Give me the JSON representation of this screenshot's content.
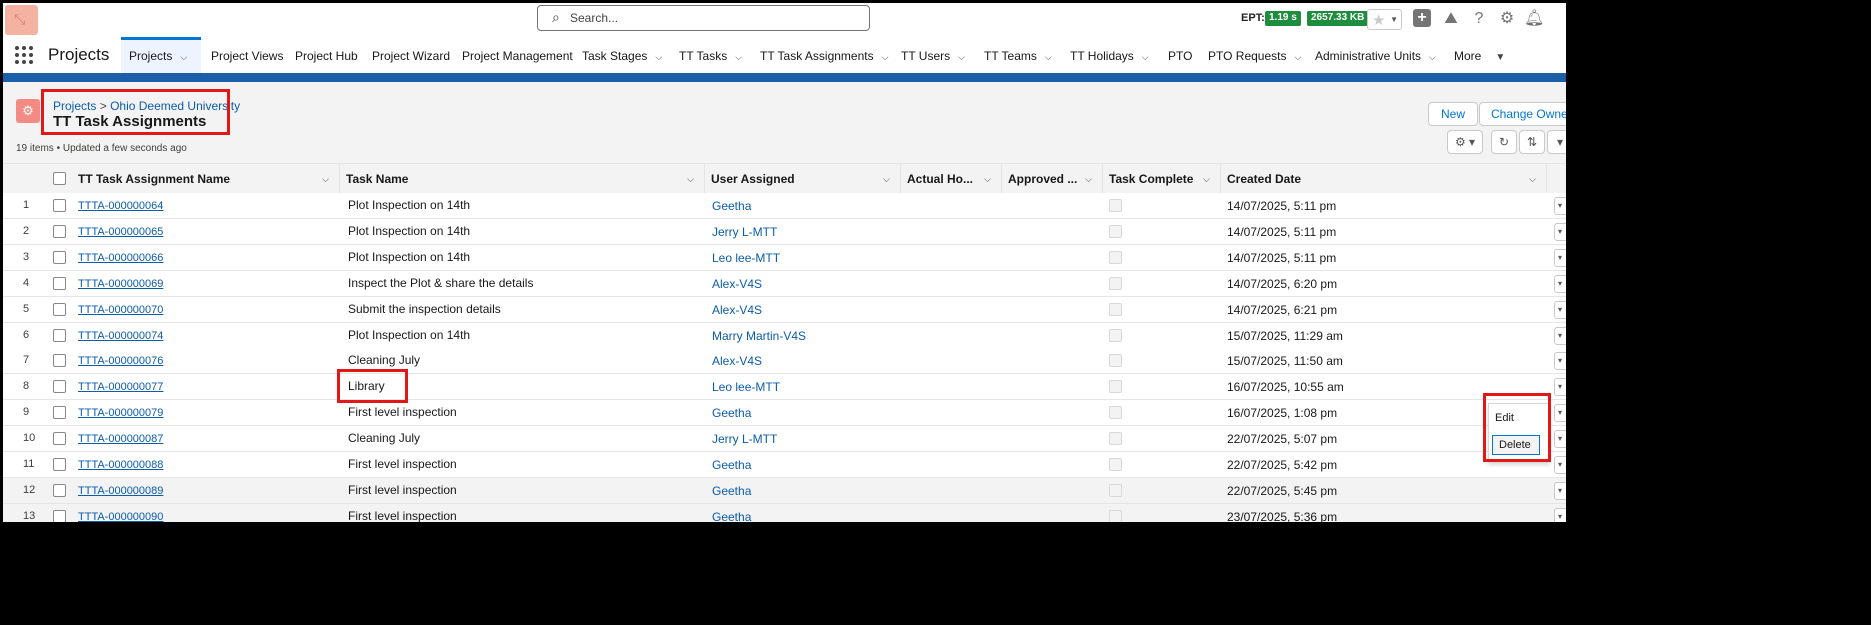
{
  "header": {
    "search_placeholder": "Search...",
    "ept_label": "EPT:",
    "ept_time": "1.19 s",
    "ept_size": "2657.33 KB"
  },
  "nav": {
    "app_name": "Projects",
    "items": [
      {
        "label": "Projects",
        "active": true,
        "dropdown": true
      },
      {
        "label": "Project Views"
      },
      {
        "label": "Project Hub"
      },
      {
        "label": "Project Wizard"
      },
      {
        "label": "Project Management"
      },
      {
        "label": "Task Stages",
        "dropdown": true
      },
      {
        "label": "TT Tasks",
        "dropdown": true
      },
      {
        "label": "TT Task Assignments",
        "dropdown": true
      },
      {
        "label": "TT Users",
        "dropdown": true
      },
      {
        "label": "TT Teams",
        "dropdown": true
      },
      {
        "label": "TT Holidays",
        "dropdown": true
      },
      {
        "label": "PTO"
      },
      {
        "label": "PTO Requests",
        "dropdown": true
      },
      {
        "label": "Administrative Units",
        "dropdown": true
      },
      {
        "label": "More",
        "dropdown": true
      }
    ]
  },
  "page": {
    "breadcrumb_root": "Projects",
    "breadcrumb_sep": ">",
    "breadcrumb_record": "Ohio Deemed University",
    "title": "TT Task Assignments",
    "meta": "19 items • Updated a few seconds ago",
    "new_button": "New",
    "change_owner_button": "Change Owner"
  },
  "table": {
    "columns": [
      "TT Task Assignment Name",
      "Task Name",
      "User Assigned",
      "Actual Ho...",
      "Approved ...",
      "Task Complete",
      "Created Date"
    ],
    "rows": [
      {
        "num": "1",
        "name": "TTTA-000000064",
        "task": "Plot Inspection on 14th",
        "user": "Geetha",
        "date": "14/07/2025, 5:11 pm"
      },
      {
        "num": "2",
        "name": "TTTA-000000065",
        "task": "Plot Inspection on 14th",
        "user": "Jerry L-MTT",
        "date": "14/07/2025, 5:11 pm"
      },
      {
        "num": "3",
        "name": "TTTA-000000066",
        "task": "Plot Inspection on 14th",
        "user": "Leo lee-MTT",
        "date": "14/07/2025, 5:11 pm"
      },
      {
        "num": "4",
        "name": "TTTA-000000069",
        "task": "Inspect the Plot & share the details",
        "user": "Alex-V4S",
        "date": "14/07/2025, 6:20 pm"
      },
      {
        "num": "5",
        "name": "TTTA-000000070",
        "task": "Submit the inspection details",
        "user": "Alex-V4S",
        "date": "14/07/2025, 6:21 pm"
      },
      {
        "num": "6",
        "name": "TTTA-000000074",
        "task": "Plot Inspection on 14th",
        "user": "Marry Martin-V4S",
        "date": "15/07/2025, 11:29 am"
      },
      {
        "num": "7",
        "name": "TTTA-000000076",
        "task": "Cleaning July",
        "user": "Alex-V4S",
        "date": "15/07/2025, 11:50 am"
      },
      {
        "num": "8",
        "name": "TTTA-000000077",
        "task": "Library",
        "user": "Leo lee-MTT",
        "date": "16/07/2025, 10:55 am"
      },
      {
        "num": "9",
        "name": "TTTA-000000079",
        "task": "First level inspection",
        "user": "Geetha",
        "date": "16/07/2025, 1:08 pm"
      },
      {
        "num": "10",
        "name": "TTTA-000000087",
        "task": "Cleaning July",
        "user": "Jerry L-MTT",
        "date": "22/07/2025, 5:07 pm"
      },
      {
        "num": "11",
        "name": "TTTA-000000088",
        "task": "First level inspection",
        "user": "Geetha",
        "date": "22/07/2025, 5:42 pm"
      },
      {
        "num": "12",
        "name": "TTTA-000000089",
        "task": "First level inspection",
        "user": "Geetha",
        "date": "22/07/2025, 5:45 pm"
      },
      {
        "num": "13",
        "name": "TTTA-000000090",
        "task": "First level inspection",
        "user": "Geetha",
        "date": "23/07/2025, 5:36 pm"
      }
    ]
  },
  "row_menu": {
    "edit": "Edit",
    "delete": "Delete"
  },
  "colors": {
    "accent": "#0176d3",
    "link": "#0b5cab",
    "highlight": "#e01818",
    "ept_badge": "#1e8e3e"
  },
  "icons": [
    "search-icon",
    "star-icon",
    "plus-icon",
    "trailhead-icon",
    "help-icon",
    "gear-icon",
    "bell-icon",
    "waffle-icon",
    "settings-icon",
    "refresh-icon",
    "sort-icon"
  ]
}
